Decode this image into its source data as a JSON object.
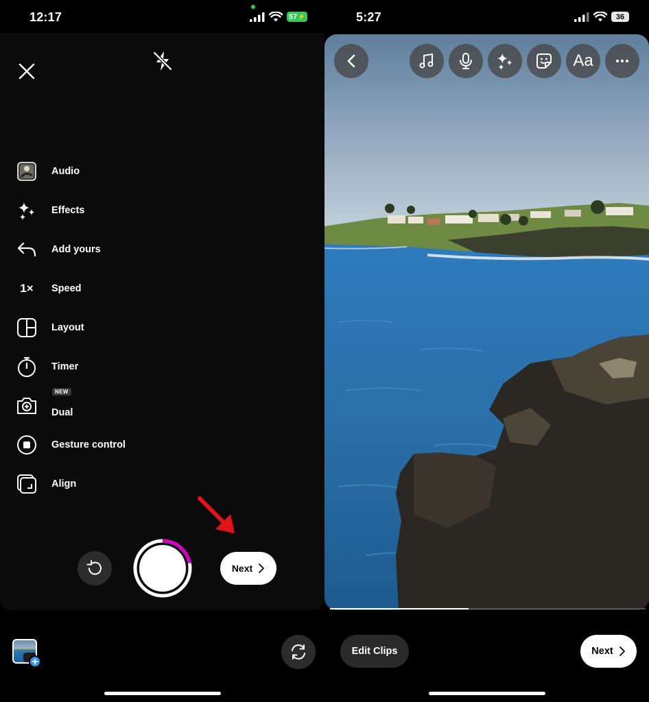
{
  "left": {
    "status": {
      "time": "12:17",
      "battery": "57"
    },
    "tools": [
      {
        "label": "Audio",
        "icon": "audio-thumbnail-icon"
      },
      {
        "label": "Effects",
        "icon": "sparkles-icon"
      },
      {
        "label": "Add yours",
        "icon": "reply-arrow-icon"
      },
      {
        "label": "Speed",
        "icon": "speed-icon",
        "glyph": "1×"
      },
      {
        "label": "Layout",
        "icon": "layout-grid-icon"
      },
      {
        "label": "Timer",
        "icon": "timer-icon"
      },
      {
        "label": "Dual",
        "icon": "dual-camera-icon",
        "badge": "NEW"
      },
      {
        "label": "Gesture control",
        "icon": "gesture-control-icon"
      },
      {
        "label": "Align",
        "icon": "align-icon"
      }
    ],
    "next_label": "Next",
    "record_progress": 0.22,
    "accent_color": "#d300c5"
  },
  "right": {
    "status": {
      "time": "5:27",
      "battery": "36"
    },
    "text_tool_label": "Aa",
    "edit_clips_label": "Edit Clips",
    "next_label": "Next"
  }
}
